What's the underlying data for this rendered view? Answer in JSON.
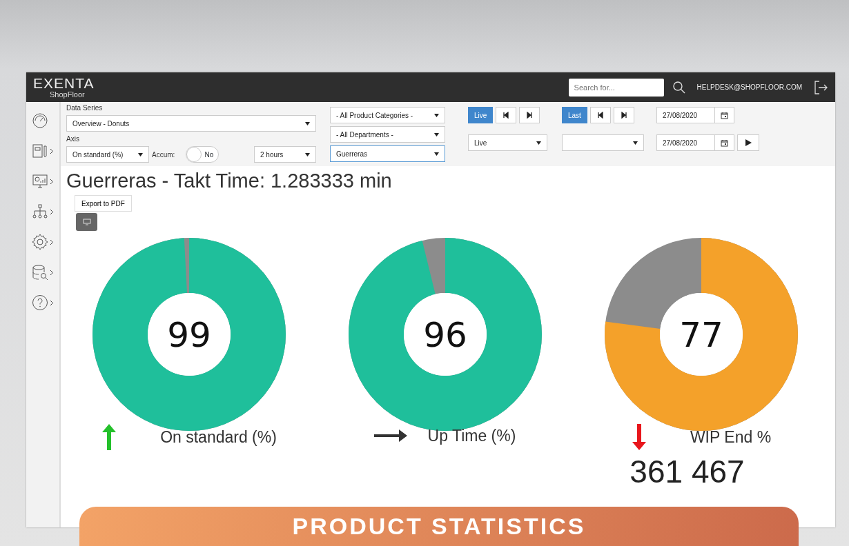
{
  "app": {
    "logo": "EXENTA",
    "logo_sub": "ShopFloor",
    "search": {
      "placeholder": "Search for..."
    },
    "user": "HELPDESK@SHOPFLOOR.COM"
  },
  "sidebar": {
    "items": [
      {
        "kind": "gauge",
        "has_submenu": false
      },
      {
        "kind": "notebook",
        "has_submenu": true
      },
      {
        "kind": "monitor",
        "has_submenu": true
      },
      {
        "kind": "hierarchy",
        "has_submenu": true
      },
      {
        "kind": "gear",
        "has_submenu": true
      },
      {
        "kind": "database",
        "has_submenu": true
      },
      {
        "kind": "help",
        "has_submenu": true
      }
    ]
  },
  "filters": {
    "data_series_label": "Data Series",
    "data_series": "Overview - Donuts",
    "axis_label": "Axis",
    "axis": "On standard (%)",
    "accum_label": "Accum:",
    "accum": {
      "on": false,
      "label": "No"
    },
    "period": "2 hours",
    "category_filters": [
      {
        "value": "- All Product Categories -",
        "focused": false
      },
      {
        "value": "- All Departments -",
        "focused": false
      },
      {
        "value": "Guerreras",
        "focused": true
      }
    ],
    "start": {
      "button": {
        "label": "Live",
        "selected": true
      },
      "mode": "Live"
    },
    "end": {
      "button": {
        "label": "Last",
        "selected": true
      }
    },
    "from_date": "27/08/2020",
    "to_date": "27/08/2020"
  },
  "title": "Guerreras - Takt Time: 1.283333 min",
  "export_button": "Export to PDF",
  "gauges": [
    {
      "value": "99",
      "level": 0.99,
      "color": "#1fbf9b",
      "arrow": {
        "kind": "up"
      },
      "label": "On standard (%)"
    },
    {
      "value": "96",
      "level": 0.96,
      "color": "#1fbf9b",
      "arrow": {
        "kind": "flat"
      },
      "label": "Up Time (%)"
    },
    {
      "value": "77",
      "level": 0.77,
      "color": "#f4a12a",
      "arrow": {
        "kind": "down"
      },
      "label": "WIP End %",
      "total": "361 467"
    }
  ],
  "banner": "PRODUCT STATISTICS"
}
